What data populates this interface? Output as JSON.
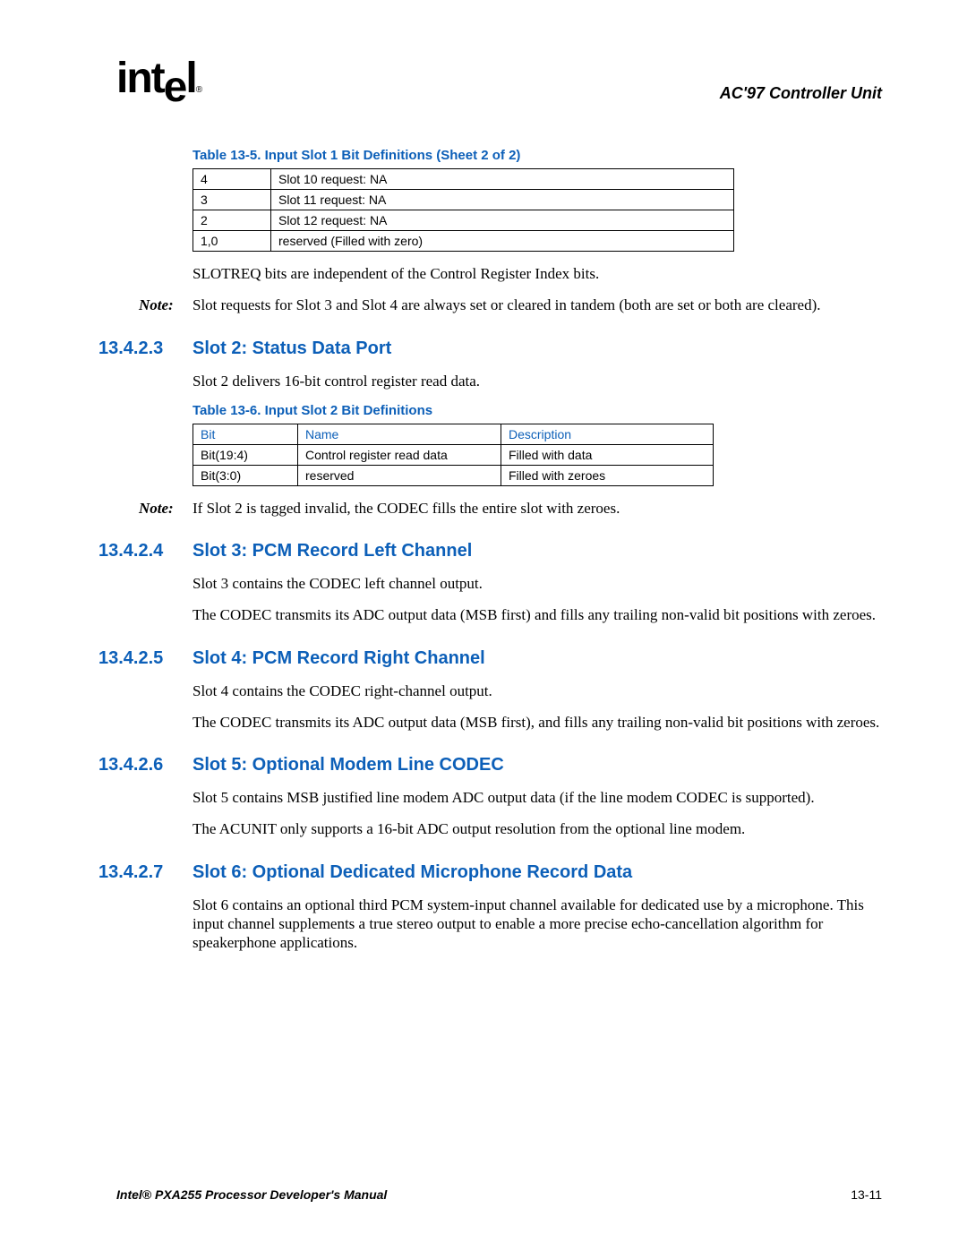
{
  "header": {
    "logo_text": "intel",
    "title": "AC'97 Controller Unit"
  },
  "table1": {
    "caption": "Table 13-5. Input Slot 1 Bit Definitions (Sheet 2 of 2)",
    "rows": [
      {
        "c0": "4",
        "c1": "Slot 10 request: NA"
      },
      {
        "c0": "3",
        "c1": "Slot 11 request: NA"
      },
      {
        "c0": "2",
        "c1": "Slot 12 request: NA"
      },
      {
        "c0": "1,0",
        "c1": "reserved (Filled with zero)"
      }
    ]
  },
  "para_slotreq": "SLOTREQ bits are independent of the Control Register Index bits.",
  "note1": {
    "label": "Note:",
    "text": "Slot requests for Slot 3 and Slot 4 are always set or cleared in tandem (both are set or both are cleared)."
  },
  "sec3": {
    "num": "13.4.2.3",
    "title": "Slot 2: Status Data Port"
  },
  "para_s2": "Slot 2 delivers 16-bit control register read data.",
  "table2": {
    "caption": "Table 13-6. Input Slot 2 Bit Definitions",
    "headers": {
      "h0": "Bit",
      "h1": "Name",
      "h2": "Description"
    },
    "rows": [
      {
        "c0": "Bit(19:4)",
        "c1": "Control register read data",
        "c2": "Filled with data"
      },
      {
        "c0": "Bit(3:0)",
        "c1": "reserved",
        "c2": "Filled with zeroes"
      }
    ]
  },
  "note2": {
    "label": "Note:",
    "text": "If Slot 2 is tagged invalid, the CODEC fills the entire slot with zeroes."
  },
  "sec4": {
    "num": "13.4.2.4",
    "title": "Slot 3: PCM Record Left Channel"
  },
  "para_s3a": "Slot 3 contains the CODEC left channel output.",
  "para_s3b": "The CODEC transmits its ADC output data (MSB first) and fills any trailing non-valid bit positions with zeroes.",
  "sec5": {
    "num": "13.4.2.5",
    "title": "Slot 4: PCM Record Right Channel"
  },
  "para_s4a": "Slot 4 contains the CODEC right-channel output.",
  "para_s4b": "The CODEC transmits its ADC output data (MSB first), and fills any trailing non-valid bit positions with zeroes.",
  "sec6": {
    "num": "13.4.2.6",
    "title": "Slot 5: Optional Modem Line CODEC"
  },
  "para_s5a": "Slot 5 contains MSB justified line modem ADC output data (if the line modem CODEC is supported).",
  "para_s5b": "The ACUNIT only supports a 16-bit ADC output resolution from the optional line modem.",
  "sec7": {
    "num": "13.4.2.7",
    "title": "Slot 6: Optional Dedicated Microphone Record Data"
  },
  "para_s6": "Slot 6 contains an optional third PCM system-input channel available for dedicated use by a microphone. This input channel supplements a true stereo output to enable a more precise echo-cancellation algorithm for speakerphone applications.",
  "footer": {
    "left": "Intel® PXA255 Processor Developer's Manual",
    "right": "13-11"
  }
}
